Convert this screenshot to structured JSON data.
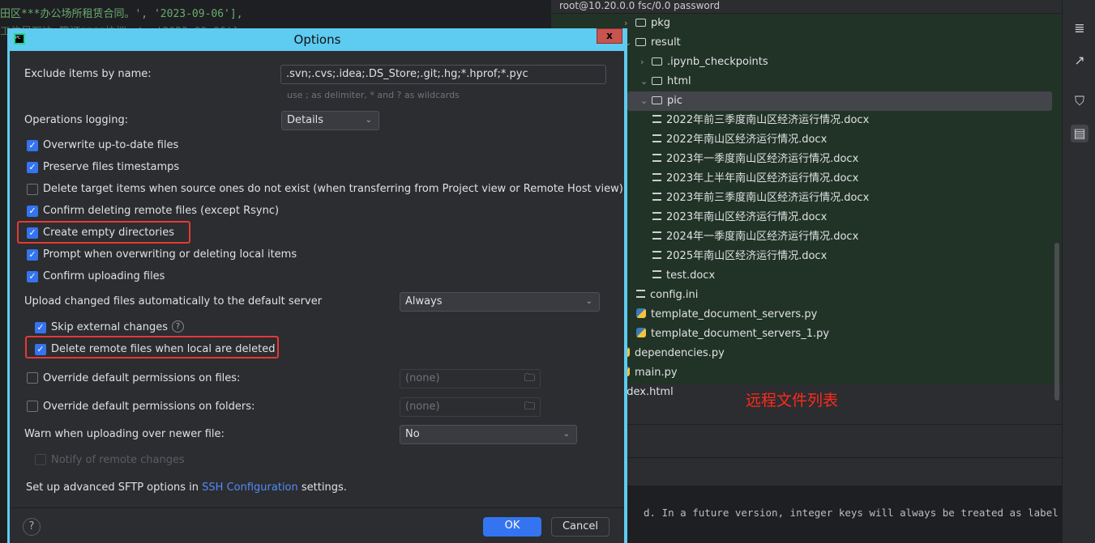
{
  "background_code": {
    "line1": "田区***办公场所租赁合同。', '2023-09-06'],",
    "line2": "工信局万达 签订****协议。', '2023-09-06'],"
  },
  "remote_panel": {
    "title": "root@10.20.0.0 fsc/0.0 password",
    "items": [
      {
        "name": "pkg",
        "type": "folder",
        "expanded": false
      },
      {
        "name": "result",
        "type": "folder",
        "expanded": true
      },
      {
        "name": ".ipynb_checkpoints",
        "type": "folder",
        "expanded": false
      },
      {
        "name": "html",
        "type": "folder",
        "expanded": true
      },
      {
        "name": "pic",
        "type": "folder",
        "expanded": true,
        "selected": true
      },
      {
        "name": "2022年前三季度南山区经济运行情况.docx",
        "type": "file"
      },
      {
        "name": "2022年南山区经济运行情况.docx",
        "type": "file"
      },
      {
        "name": "2023年一季度南山区经济运行情况.docx",
        "type": "file"
      },
      {
        "name": "2023年上半年南山区经济运行情况.docx",
        "type": "file"
      },
      {
        "name": "2023年前三季度南山区经济运行情况.docx",
        "type": "file"
      },
      {
        "name": "2023年南山区经济运行情况.docx",
        "type": "file"
      },
      {
        "name": "2024年一季度南山区经济运行情况.docx",
        "type": "file"
      },
      {
        "name": "2025年南山区经济运行情况.docx",
        "type": "file"
      },
      {
        "name": "test.docx",
        "type": "file"
      },
      {
        "name": "config.ini",
        "type": "file"
      },
      {
        "name": "template_document_servers.py",
        "type": "py"
      },
      {
        "name": "template_document_servers_1.py",
        "type": "py"
      },
      {
        "name": "dependencies.py",
        "type": "py"
      },
      {
        "name": "main.py",
        "type": "py"
      },
      {
        "name": "ndex.html",
        "type": "file"
      }
    ],
    "annotation": "远程文件列表",
    "annotation_color": "#ff2a1a"
  },
  "console": {
    "text": "d. In a future version, integer keys will always be treated as label"
  },
  "dialog": {
    "title": "Options",
    "close": "x",
    "exclude_label": "Exclude items by name:",
    "exclude_value": ".svn;.cvs;.idea;.DS_Store;.git;.hg;*.hprof;*.pyc",
    "exclude_hint": "use ; as delimiter, * and ? as wildcards",
    "logging_label": "Operations logging:",
    "logging_value": "Details",
    "checkboxes": [
      {
        "label": "Overwrite up-to-date files",
        "checked": true
      },
      {
        "label": "Preserve files timestamps",
        "checked": true
      },
      {
        "label": "Delete target items when source ones do not exist (when transferring from Project view or Remote Host view)",
        "checked": false
      },
      {
        "label": "Confirm deleting remote files (except Rsync)",
        "checked": true
      },
      {
        "label": "Create empty directories",
        "checked": true,
        "highlighted": true
      },
      {
        "label": "Prompt when overwriting or deleting local items",
        "checked": true
      },
      {
        "label": "Confirm uploading files",
        "checked": true
      }
    ],
    "upload_label": "Upload changed files automatically to the default server",
    "upload_value": "Always",
    "skip_external": {
      "label": "Skip external changes",
      "checked": true
    },
    "delete_remote": {
      "label": "Delete remote files when local are deleted",
      "checked": true,
      "highlighted": true
    },
    "perm_files": {
      "label": "Override default permissions on files:",
      "checked": false,
      "value": "(none)"
    },
    "perm_folders": {
      "label": "Override default permissions on folders:",
      "checked": false,
      "value": "(none)"
    },
    "warn_label": "Warn when uploading over newer file:",
    "warn_value": "No",
    "notify": {
      "label": "Notify of remote changes",
      "checked": false,
      "disabled": true
    },
    "sftp_prefix": "Set up advanced SFTP options in",
    "sftp_link": "SSH Configuration",
    "sftp_suffix": "settings.",
    "help": "?",
    "ok": "OK",
    "cancel": "Cancel",
    "accent": "#3574f0",
    "highlight_color": "#e53935"
  }
}
